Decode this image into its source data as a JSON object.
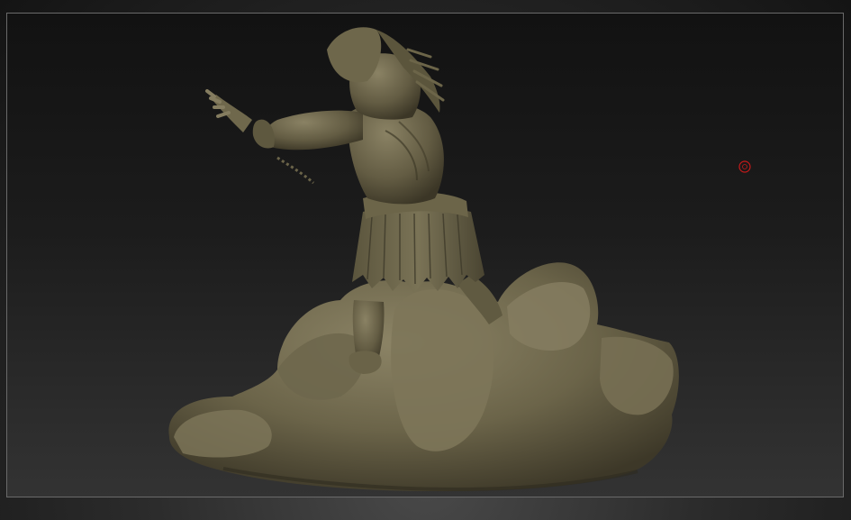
{
  "viewport": {
    "background_color": "#1a1a1a",
    "frame_color": "#6a6a6a"
  },
  "model": {
    "icon": "sculpted-figure",
    "material_color": "#7a7256"
  },
  "cursor": {
    "icon": "brush-target-icon",
    "color": "#c41a1a"
  }
}
